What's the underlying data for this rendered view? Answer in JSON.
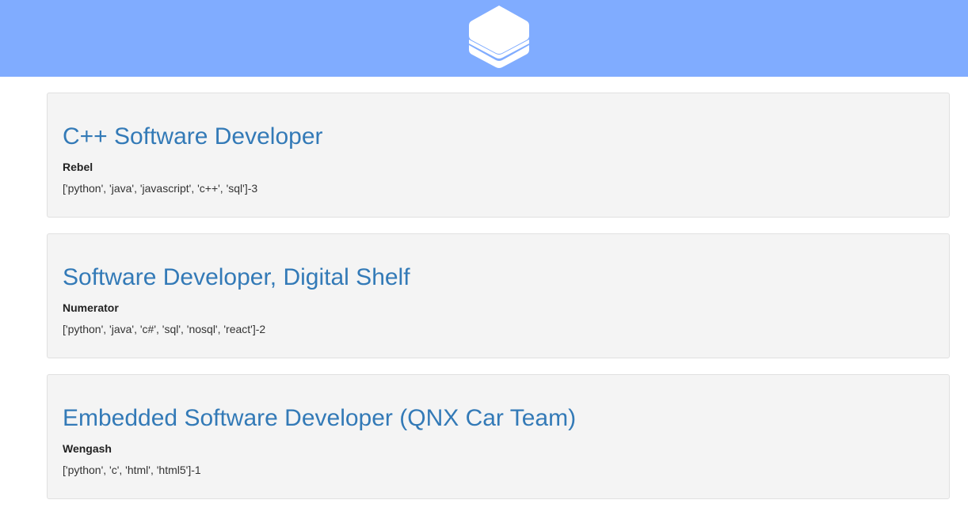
{
  "header": {
    "logo_icon": "stacked-layers-icon",
    "background_color": "#80acff"
  },
  "jobs": [
    {
      "title": "C++ Software Developer",
      "company": "Rebel",
      "skills": "['python', 'java', 'javascript', 'c++', 'sql']-3"
    },
    {
      "title": "Software Developer, Digital Shelf",
      "company": "Numerator",
      "skills": "['python', 'java', 'c#', 'sql', 'nosql', 'react']-2"
    },
    {
      "title": "Embedded Software Developer (QNX Car Team)",
      "company": "Wengash",
      "skills": "['python', 'c', 'html', 'html5']-1"
    }
  ],
  "colors": {
    "title": "#337ab7",
    "card_background": "#f4f4f4"
  }
}
